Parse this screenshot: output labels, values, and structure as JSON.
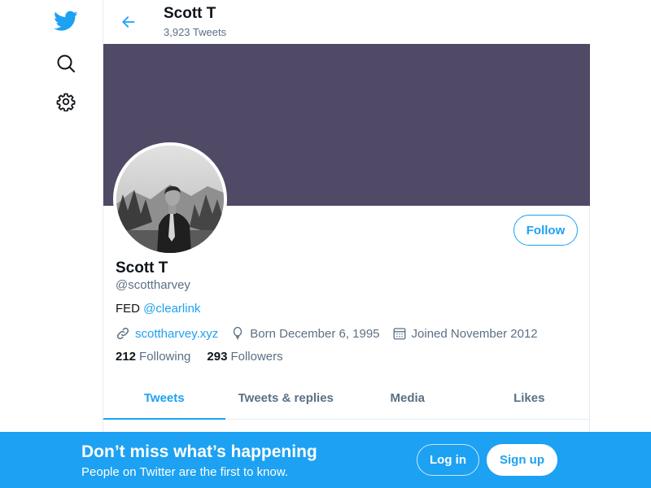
{
  "header": {
    "name": "Scott T",
    "tweet_count": "3,923 Tweets"
  },
  "nav": {
    "icons": [
      "twitter-logo-icon",
      "search-icon",
      "gear-icon"
    ]
  },
  "profile": {
    "name": "Scott T",
    "handle": "@scottharvey",
    "bio_prefix": "FED",
    "bio_link": "@clearlink",
    "website": "scottharvey.xyz",
    "born": "Born December 6, 1995",
    "joined": "Joined November 2012",
    "following_count": "212",
    "following_label": "Following",
    "followers_count": "293",
    "followers_label": "Followers",
    "follow_button": "Follow"
  },
  "tabs": [
    {
      "label": "Tweets",
      "active": true
    },
    {
      "label": "Tweets & replies",
      "active": false
    },
    {
      "label": "Media",
      "active": false
    },
    {
      "label": "Likes",
      "active": false
    }
  ],
  "bottom_bar": {
    "title": "Don’t miss what’s happening",
    "subtitle": "People on Twitter are the first to know.",
    "login_label": "Log in",
    "signup_label": "Sign up"
  },
  "colors": {
    "accent": "#1da1f2",
    "banner": "#514a66",
    "text_secondary": "#5b7083"
  }
}
